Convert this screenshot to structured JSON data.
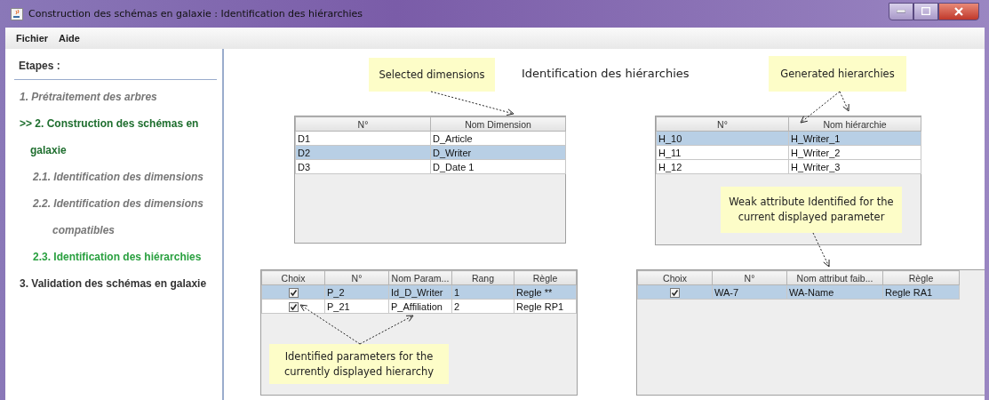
{
  "window": {
    "title": "Construction des schémas en galaxie : Identification des hiérarchies"
  },
  "menu": [
    "Fichier",
    "Aide"
  ],
  "sidebar": {
    "heading": "Etapes :",
    "steps": [
      {
        "label": "1. Prétraitement des arbres",
        "kind": "done"
      },
      {
        "label": ">> 2. Construction des schémas en galaxie",
        "kind": "current"
      },
      {
        "label": "2.1. Identification des dimensions",
        "kind": "sub_done"
      },
      {
        "label": "2.2. Identification des dimensions compatibles",
        "kind": "sub_done"
      },
      {
        "label": "2.3. Identification des hiérarchies",
        "kind": "sub_current"
      },
      {
        "label": "3. Validation des schémas en galaxie",
        "kind": "pending"
      }
    ]
  },
  "main": {
    "title": "Identification des hiérarchies"
  },
  "dimensions_table": {
    "columns": [
      "N°",
      "Nom Dimension"
    ],
    "rows": [
      {
        "cells": [
          "D1",
          "D_Article"
        ],
        "selected": false
      },
      {
        "cells": [
          "D2",
          "D_Writer"
        ],
        "selected": true
      },
      {
        "cells": [
          "D3",
          "D_Date 1"
        ],
        "selected": false
      }
    ]
  },
  "hierarchies_table": {
    "columns": [
      "N°",
      "Nom hiérarchie"
    ],
    "rows": [
      {
        "cells": [
          "H_10",
          "H_Writer_1"
        ],
        "selected": true
      },
      {
        "cells": [
          "H_11",
          "H_Writer_2"
        ],
        "selected": false
      },
      {
        "cells": [
          "H_12",
          "H_Writer_3"
        ],
        "selected": false
      }
    ]
  },
  "parameters_table": {
    "columns": [
      "Choix",
      "N°",
      "Nom Param...",
      "Rang",
      "Règle"
    ],
    "rows": [
      {
        "checked": true,
        "cells": [
          "",
          "P_2",
          "Id_D_Writer",
          "1",
          "Regle **"
        ],
        "selected": true
      },
      {
        "checked": true,
        "cells": [
          "",
          "P_21",
          "P_Affiliation",
          "2",
          "Regle RP1"
        ],
        "selected": false
      }
    ]
  },
  "weak_attributes_table": {
    "columns": [
      "Choix",
      "N°",
      "Nom attribut faib...",
      "Règle"
    ],
    "rows": [
      {
        "checked": true,
        "cells": [
          "",
          "WA-7",
          "WA-Name",
          "Regle RA1"
        ],
        "selected": true
      }
    ]
  },
  "callouts": [
    {
      "text": "Selected dimensions"
    },
    {
      "text": "Generated hierarchies"
    },
    {
      "text": "Weak attribute Identified for the current displayed parameter"
    },
    {
      "text": "Identified parameters for the currently displayed hierarchy"
    }
  ]
}
